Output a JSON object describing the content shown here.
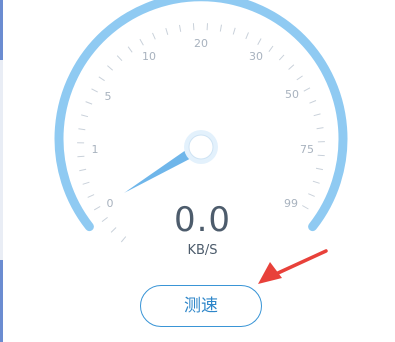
{
  "speed": {
    "value": "0.0",
    "unit": "KB/S",
    "needle_value": 0
  },
  "gauge": {
    "labels": [
      "0",
      "1",
      "5",
      "10",
      "20",
      "30",
      "50",
      "75",
      "99"
    ],
    "arc_color": "#8fcaf2",
    "tick_color": "#c9d1da",
    "needle_color": "#6fb6ea"
  },
  "button": {
    "label": "测速",
    "color": "#3a95d6"
  },
  "annotation": {
    "arrow_color": "#e8413a"
  },
  "left_strip": {
    "colors": [
      "#6b8cd1",
      "#e9edf5",
      "#6b8cd1"
    ]
  }
}
